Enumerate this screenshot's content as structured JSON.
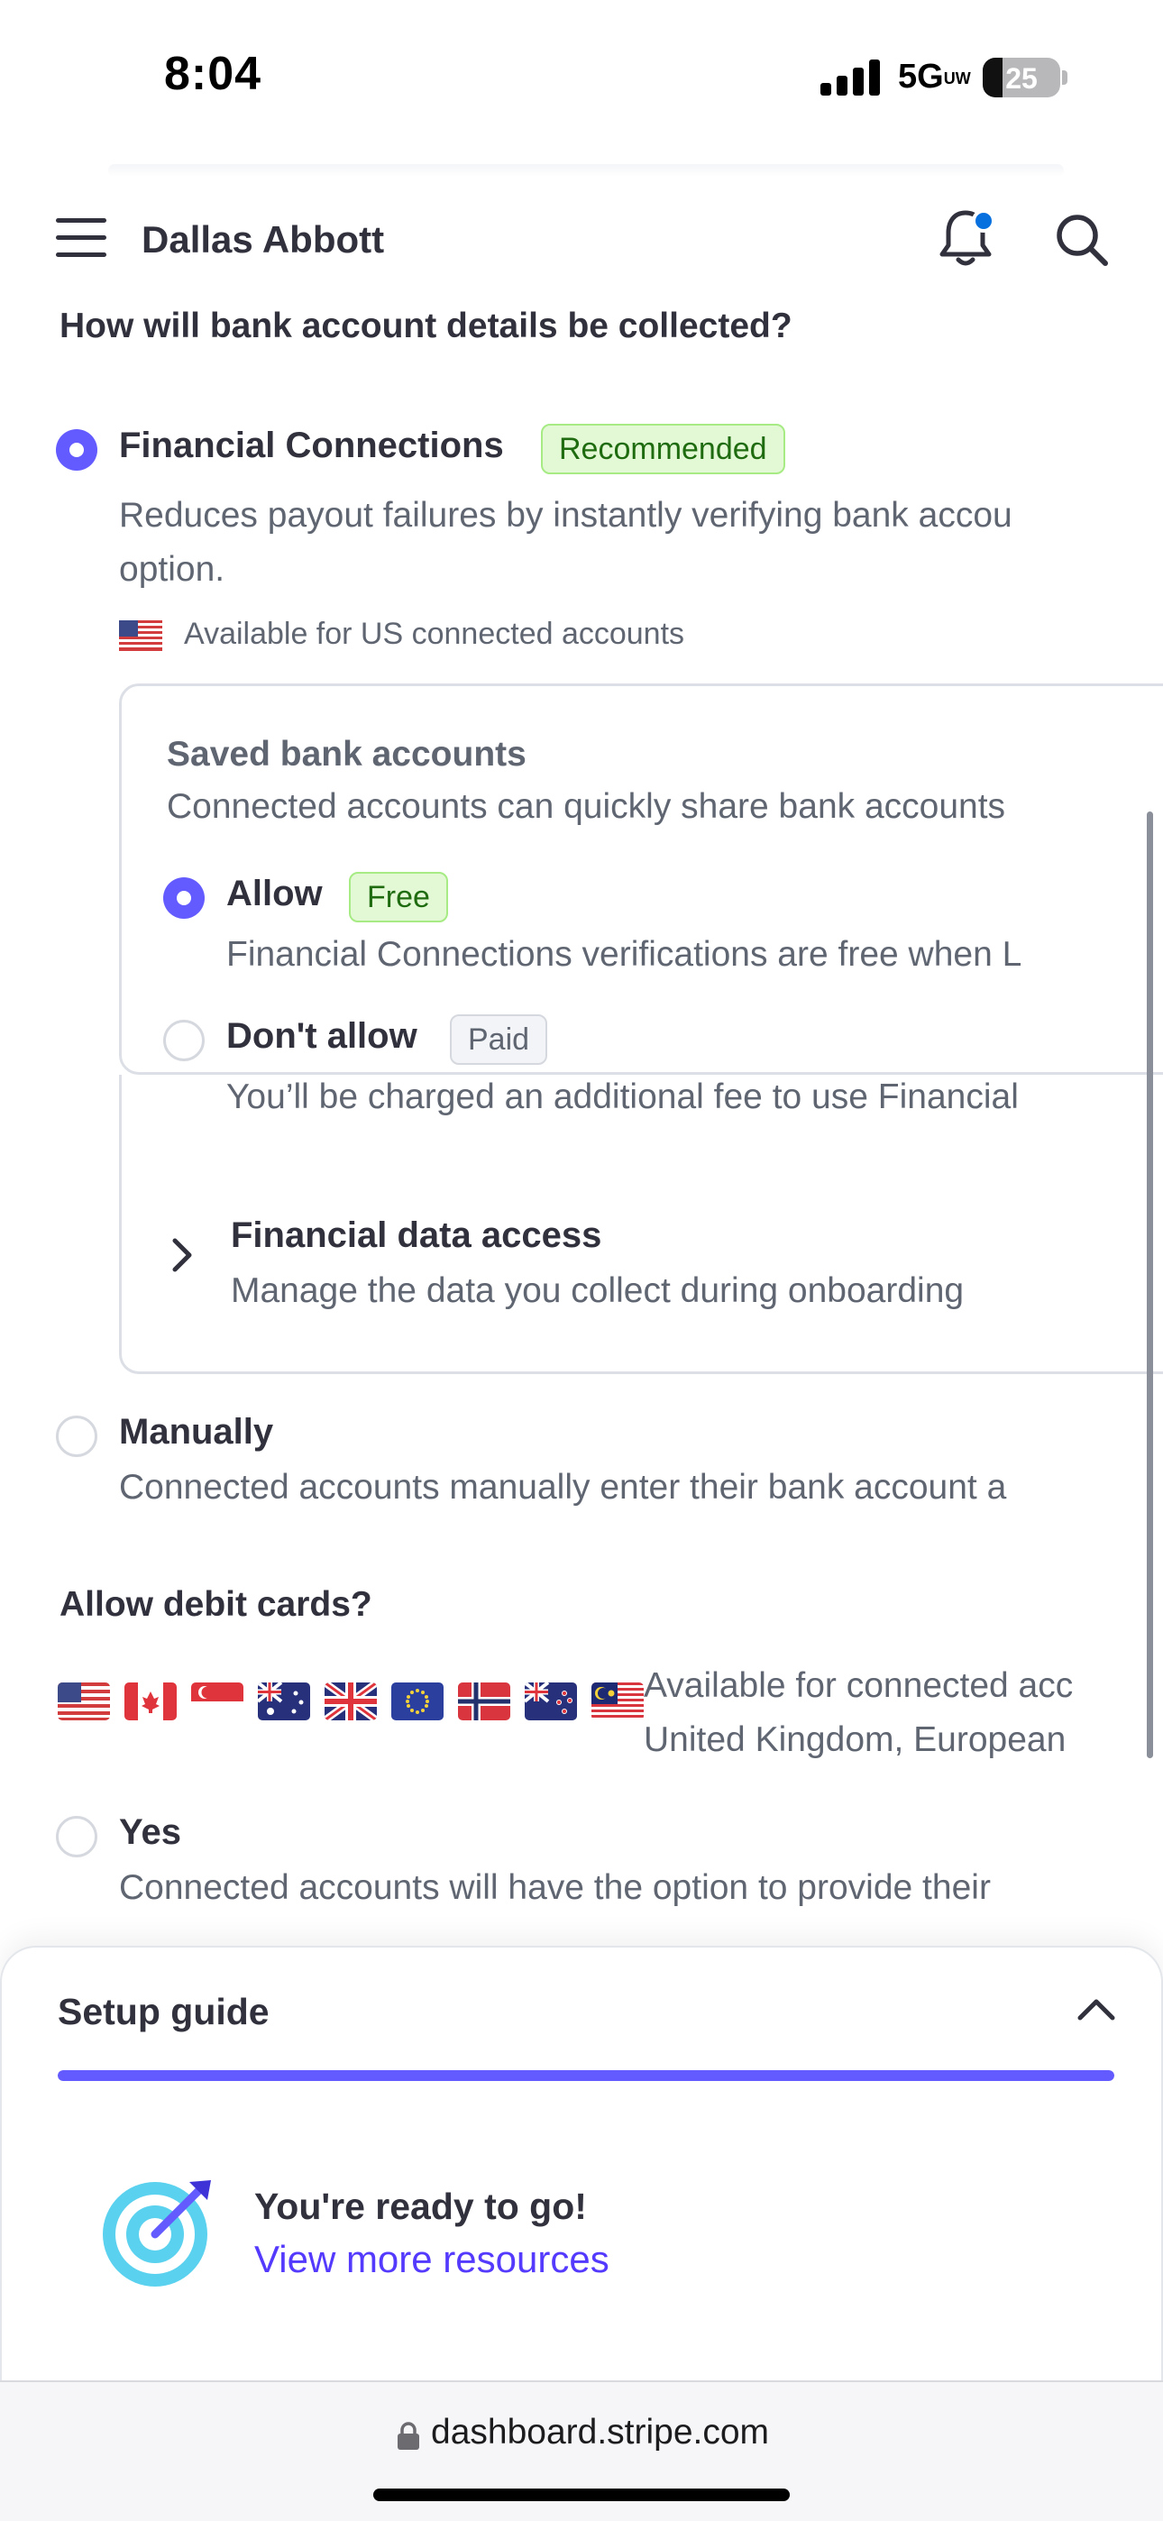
{
  "status_bar": {
    "time": "8:04",
    "network": "5G",
    "network_suffix": "UW",
    "battery": "25",
    "battery_level_pct": 25
  },
  "header": {
    "menu_icon": "hamburger-menu-icon",
    "account_name": "Dallas Abbott",
    "notifications_icon": "bell-icon",
    "has_unread_notifications": true,
    "search_icon": "search-icon"
  },
  "bank_details": {
    "question": "How will bank account details be collected?",
    "financial_connections": {
      "title": "Financial Connections",
      "badge": "Recommended",
      "desc_line1": "Reduces payout failures by instantly verifying bank accou",
      "desc_line2": "option.",
      "availability": "Available for US connected accounts",
      "selected": true
    },
    "saved_bank_accounts": {
      "title": "Saved bank accounts",
      "desc": "Connected accounts can quickly share bank accounts",
      "allow": {
        "title": "Allow",
        "badge": "Free",
        "desc": "Financial Connections verifications are free when L",
        "selected": true
      },
      "dont_allow": {
        "title": "Don't allow",
        "badge": "Paid",
        "desc": "You’ll be charged an additional fee to use Financial",
        "selected": false
      }
    },
    "financial_data_access": {
      "title": "Financial data access",
      "desc": "Manage the data you collect during onboarding"
    },
    "manually": {
      "title": "Manually",
      "desc": "Connected accounts manually enter their bank account a",
      "selected": false
    }
  },
  "debit_cards": {
    "question": "Allow debit cards?",
    "flags": [
      "us-flag-icon",
      "ca-flag-icon",
      "sg-flag-icon",
      "au-flag-icon",
      "uk-flag-icon",
      "eu-flag-icon",
      "no-flag-icon",
      "nz-flag-icon",
      "my-flag-icon"
    ],
    "availability_line1": "Available for connected acc",
    "availability_line2": "United Kingdom, European",
    "yes": {
      "title": "Yes",
      "desc": "Connected accounts will have the option to provide their",
      "selected": false
    }
  },
  "setup_guide": {
    "title": "Setup guide",
    "progress_pct": 100,
    "ready_title": "You're ready to go!",
    "resources_link": "View more resources"
  },
  "browser": {
    "url": "dashboard.stripe.com"
  },
  "colors": {
    "accent": "#635bff",
    "link": "#533afd",
    "text": "#30313d",
    "muted": "#5f6672",
    "success_bg": "#e3f9d5",
    "notification_dot": "#0570de"
  }
}
